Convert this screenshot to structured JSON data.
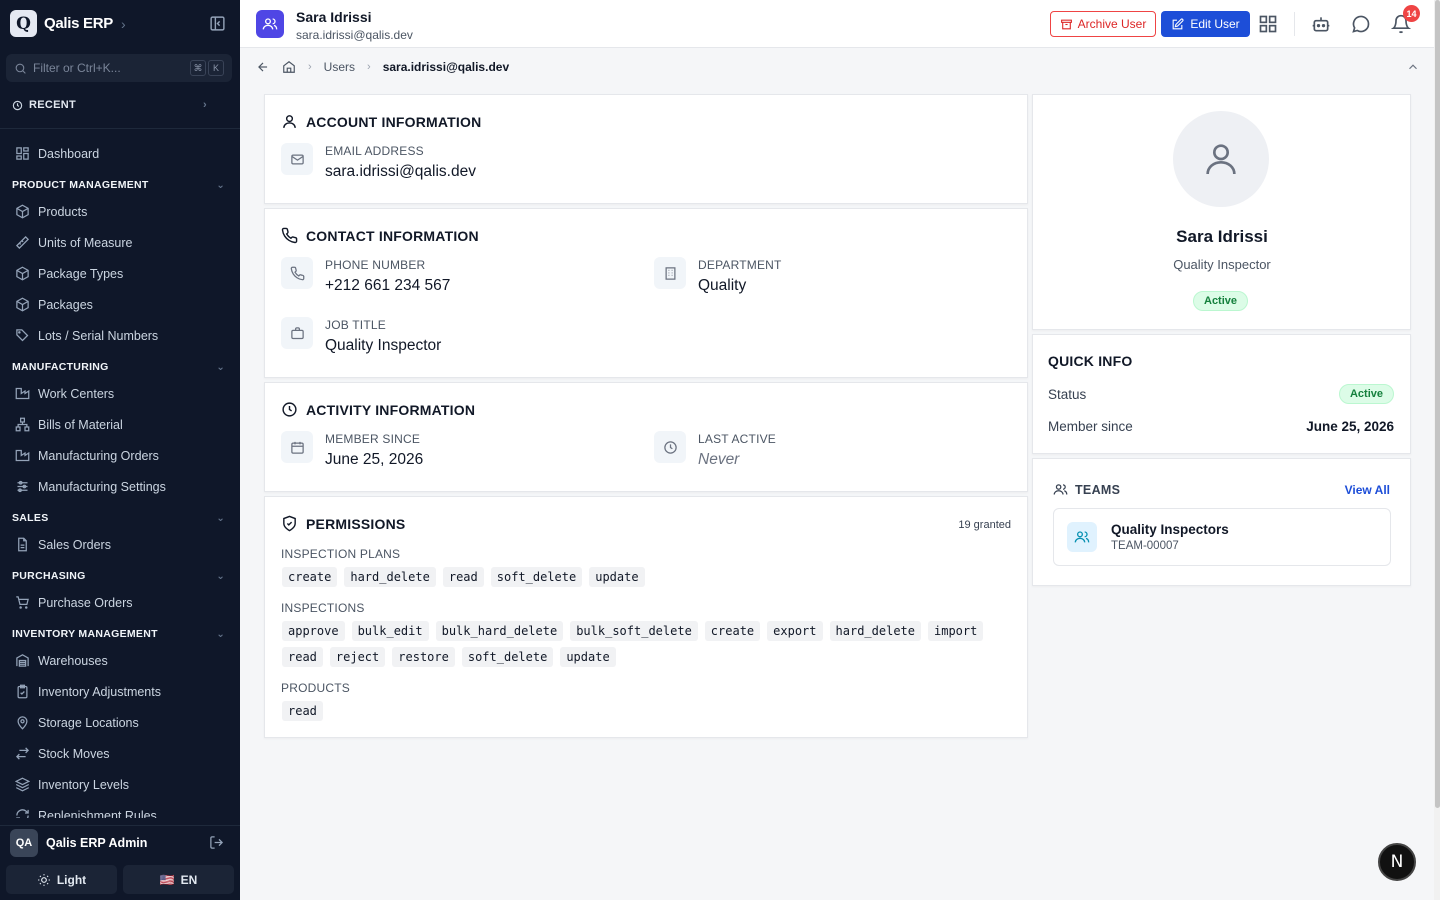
{
  "app": {
    "name": "Qalis ERP",
    "logo_letter": "Q"
  },
  "sidebar": {
    "filter_placeholder": "Filter or Ctrl+K...",
    "kbd": [
      "⌘",
      "K"
    ],
    "recent_label": "RECENT",
    "dashboard_label": "Dashboard",
    "sections": [
      {
        "title": "PRODUCT MANAGEMENT",
        "items": [
          "Products",
          "Units of Measure",
          "Package Types",
          "Packages",
          "Lots / Serial Numbers"
        ]
      },
      {
        "title": "MANUFACTURING",
        "items": [
          "Work Centers",
          "Bills of Material",
          "Manufacturing Orders",
          "Manufacturing Settings"
        ]
      },
      {
        "title": "SALES",
        "items": [
          "Sales Orders"
        ]
      },
      {
        "title": "PURCHASING",
        "items": [
          "Purchase Orders"
        ]
      },
      {
        "title": "INVENTORY MANAGEMENT",
        "items": [
          "Warehouses",
          "Inventory Adjustments",
          "Storage Locations",
          "Stock Moves",
          "Inventory Levels",
          "Replenishment Rules"
        ]
      }
    ],
    "user": {
      "initials": "QA",
      "name": "Qalis ERP Admin"
    },
    "theme_label": "Light",
    "lang_label": "EN",
    "lang_flag": "🇺🇸"
  },
  "header": {
    "title": "Sara Idrissi",
    "subtitle": "sara.idrissi@qalis.dev",
    "archive_label": "Archive User",
    "edit_label": "Edit User",
    "notification_count": "14"
  },
  "breadcrumb": {
    "parent": "Users",
    "current": "sara.idrissi@qalis.dev"
  },
  "account": {
    "title": "ACCOUNT INFORMATION",
    "email_label": "EMAIL ADDRESS",
    "email_value": "sara.idrissi@qalis.dev"
  },
  "contact": {
    "title": "CONTACT INFORMATION",
    "phone_label": "PHONE NUMBER",
    "phone_value": "+212 661 234 567",
    "department_label": "DEPARTMENT",
    "department_value": "Quality",
    "job_label": "JOB TITLE",
    "job_value": "Quality Inspector"
  },
  "activity": {
    "title": "ACTIVITY INFORMATION",
    "member_label": "MEMBER SINCE",
    "member_value": "June 25, 2026",
    "last_label": "LAST ACTIVE",
    "last_value": "Never"
  },
  "permissions": {
    "title": "PERMISSIONS",
    "count_label": "19 granted",
    "groups": [
      {
        "label": "INSPECTION PLANS",
        "perms": [
          "create",
          "hard_delete",
          "read",
          "soft_delete",
          "update"
        ]
      },
      {
        "label": "INSPECTIONS",
        "perms": [
          "approve",
          "bulk_edit",
          "bulk_hard_delete",
          "bulk_soft_delete",
          "create",
          "export",
          "hard_delete",
          "import",
          "read",
          "reject",
          "restore",
          "soft_delete",
          "update"
        ]
      },
      {
        "label": "PRODUCTS",
        "perms": [
          "read"
        ]
      }
    ]
  },
  "profile": {
    "name": "Sara Idrissi",
    "role": "Quality Inspector",
    "status": "Active"
  },
  "quick_info": {
    "title": "QUICK INFO",
    "status_label": "Status",
    "status_value": "Active",
    "member_label": "Member since",
    "member_value": "June 25, 2026"
  },
  "teams": {
    "title": "TEAMS",
    "view_all": "View All",
    "items": [
      {
        "name": "Quality Inspectors",
        "code": "TEAM-00007"
      }
    ]
  },
  "floating_button": "N",
  "colors": {
    "sidebar_bg": "#0f1729",
    "primary": "#1d4ed8",
    "danger": "#dc2626",
    "success": "#15803d"
  }
}
